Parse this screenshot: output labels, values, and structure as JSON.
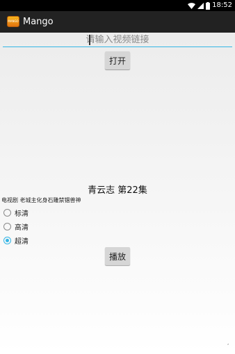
{
  "status_bar": {
    "time": "18:52",
    "icons": [
      "wifi-icon",
      "signal-icon",
      "battery-icon"
    ]
  },
  "app_bar": {
    "logo_text": "MANGO",
    "title": "Mango"
  },
  "url_input": {
    "value": "",
    "placeholder": "请输入视频链接"
  },
  "open_button": {
    "label": "打开"
  },
  "video": {
    "title": "青云志 第22集",
    "description": "电视剧 老城主化身石雕禁锢兽神"
  },
  "quality_options": [
    {
      "label": "标清",
      "checked": false
    },
    {
      "label": "高清",
      "checked": false
    },
    {
      "label": "超清",
      "checked": true
    }
  ],
  "play_button": {
    "label": "播放"
  },
  "corner_mark": ","
}
